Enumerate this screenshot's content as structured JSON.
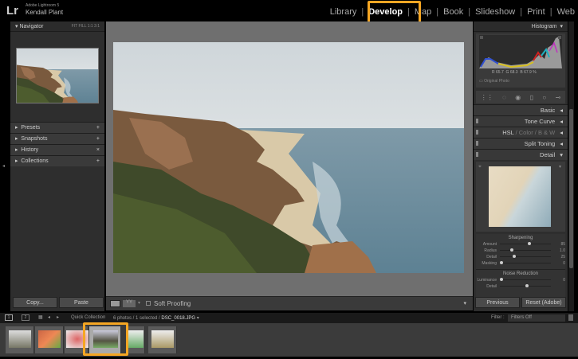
{
  "app": {
    "name": "Adobe Lightroom 5",
    "logo": "Lr",
    "user": "Kendall Plant"
  },
  "modules": [
    "Library",
    "Develop",
    "Map",
    "Book",
    "Slideshow",
    "Print",
    "Web"
  ],
  "active_module": "Develop",
  "left": {
    "navigator": {
      "title": "Navigator",
      "zoom_options": [
        "FIT",
        "FILL",
        "1:1",
        "3:1"
      ]
    },
    "sections": [
      {
        "label": "Presets",
        "action": "+"
      },
      {
        "label": "Snapshots",
        "action": "+"
      },
      {
        "label": "History",
        "action": "×"
      },
      {
        "label": "Collections",
        "action": "+"
      }
    ],
    "copy": "Copy...",
    "paste": "Paste"
  },
  "toolbar": {
    "soft_proofing": "Soft Proofing"
  },
  "right": {
    "histogram": {
      "title": "Histogram",
      "r_label": "R",
      "r": "65.7",
      "g_label": "G",
      "g": "68.3",
      "b_label": "B",
      "b": "67.9",
      "unit": "%",
      "original": "Original Photo"
    },
    "sections": {
      "basic": "Basic",
      "tone_curve": "Tone Curve",
      "hsl": "HSL",
      "color": "Color",
      "bw": "B & W",
      "split_toning": "Split Toning",
      "detail": "Detail"
    },
    "sharpening": {
      "title": "Sharpening",
      "sliders": [
        {
          "label": "Amount",
          "value": "85",
          "pos": 0.55
        },
        {
          "label": "Radius",
          "value": "1.0",
          "pos": 0.2
        },
        {
          "label": "Detail",
          "value": "25",
          "pos": 0.25
        },
        {
          "label": "Masking",
          "value": "0",
          "pos": 0
        }
      ]
    },
    "noise": {
      "title": "Noise Reduction",
      "sliders": [
        {
          "label": "Luminance",
          "value": "0",
          "pos": 0
        },
        {
          "label": "Detail",
          "value": "",
          "pos": 0.5
        }
      ]
    },
    "previous": "Previous",
    "reset": "Reset (Adobe)"
  },
  "filmstrip": {
    "views": [
      "1",
      "2"
    ],
    "source": "Quick Collection",
    "count": "6 photos / 1 selected /",
    "file": "DSC_0018.JPG",
    "filter_label": "Filter :",
    "filter_value": "Filters Off"
  }
}
